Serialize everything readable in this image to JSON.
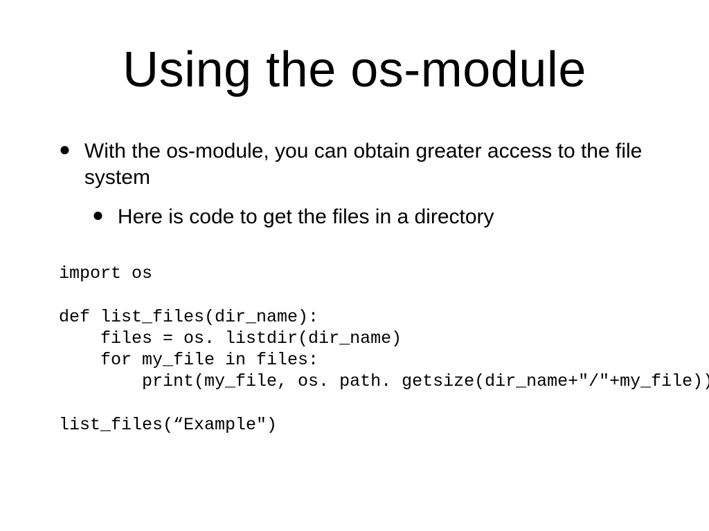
{
  "title": "Using the os-module",
  "bullets": {
    "l1": "With the os-module, you can obtain greater access to the file system",
    "l2": "Here is code to get the files in a directory"
  },
  "code": "import os\n\ndef list_files(dir_name):\n    files = os. listdir(dir_name)\n    for my_file in files:\n        print(my_file, os. path. getsize(dir_name+\"/\"+my_file))\n\nlist_files(“Example\")"
}
